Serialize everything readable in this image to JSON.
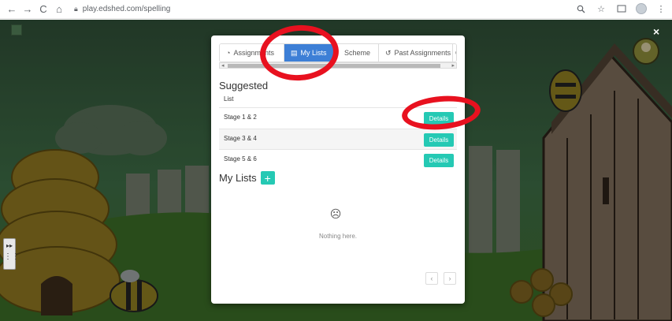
{
  "browser": {
    "url": "play.edshed.com/spelling"
  },
  "modal": {
    "tabs": [
      {
        "label": "Assignments",
        "icon": "clock-icon"
      },
      {
        "label": "My Lists",
        "icon": "document-icon"
      },
      {
        "label": "Scheme",
        "icon": "book-icon"
      },
      {
        "label": "Past Assignments",
        "icon": "history-icon"
      }
    ],
    "suggested": {
      "heading": "Suggested",
      "column": "List",
      "rows": [
        {
          "label": "Stage 1 & 2",
          "button": "Details"
        },
        {
          "label": "Stage 3 & 4",
          "button": "Details"
        },
        {
          "label": "Stage 5 & 6",
          "button": "Details"
        }
      ]
    },
    "my_lists": {
      "heading": "My Lists",
      "add_icon": "+",
      "empty_text": "Nothing here."
    },
    "close_icon": "×"
  },
  "colors": {
    "accent": "#25c9b4",
    "active_tab": "#3d7fd6",
    "annotation": "#e8111f"
  }
}
